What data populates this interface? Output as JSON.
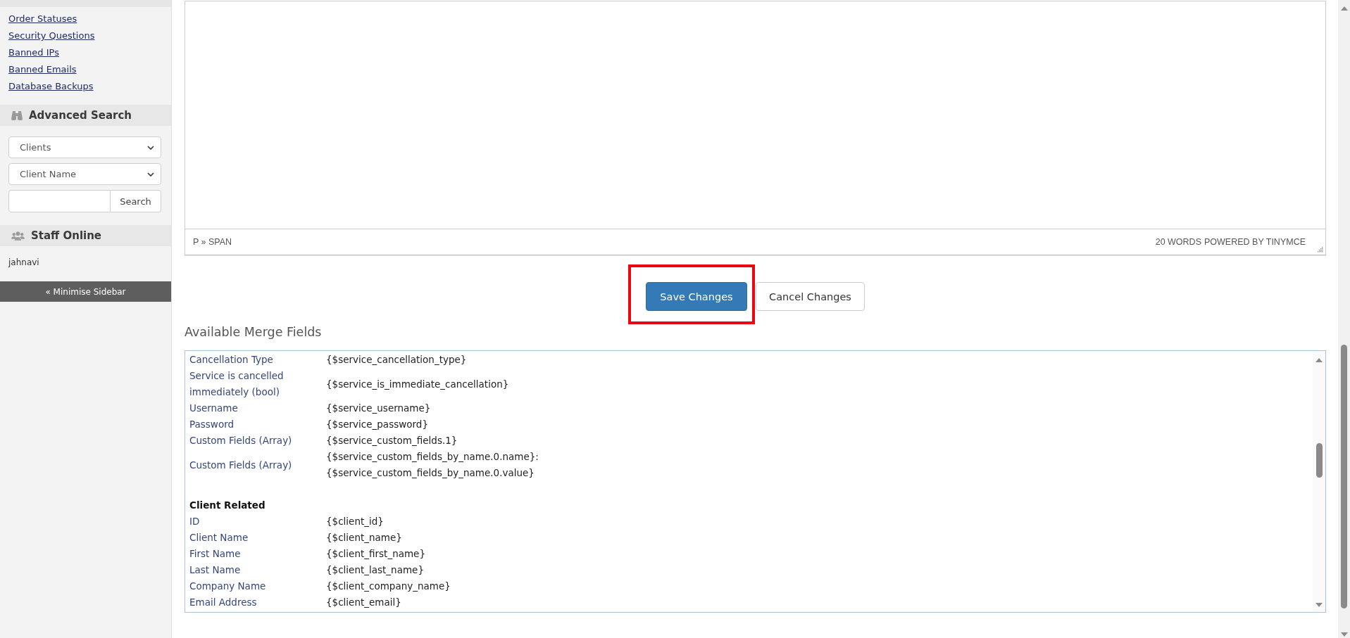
{
  "sidebar": {
    "links": [
      "Order Statuses",
      "Security Questions",
      "Banned IPs",
      "Banned Emails",
      "Database Backups"
    ],
    "advanced_search": {
      "title": "Advanced Search",
      "type_select": "Clients",
      "field_select": "Client Name",
      "search_button": "Search"
    },
    "staff_online": {
      "title": "Staff Online",
      "staff": [
        "jahnavi"
      ]
    },
    "minimise_button": "« Minimise Sidebar"
  },
  "editor": {
    "path": "P » SPAN",
    "word_count": "20 WORDS",
    "branding": "POWERED BY TINYMCE"
  },
  "actions": [
    {
      "label": "Save Changes",
      "kind": "save",
      "highlighted": true
    },
    {
      "label": "Cancel Changes",
      "kind": "cancel",
      "highlighted": false
    }
  ],
  "merge_fields": {
    "title": "Available Merge Fields",
    "rows": [
      {
        "kind": "field",
        "label": "Cancellation Type",
        "value": "{$service_cancellation_type}"
      },
      {
        "kind": "field",
        "label": "Service is cancelled immediately (bool)",
        "value": "{$service_is_immediate_cancellation}"
      },
      {
        "kind": "field",
        "label": "Username",
        "value": "{$service_username}"
      },
      {
        "kind": "field",
        "label": "Password",
        "value": "{$service_password}"
      },
      {
        "kind": "field",
        "label": "Custom Fields (Array)",
        "value": "{$service_custom_fields.1}"
      },
      {
        "kind": "field",
        "label": "Custom Fields (Array)",
        "value": "{$service_custom_fields_by_name.0.name}:\n{$service_custom_fields_by_name.0.value}"
      },
      {
        "kind": "heading",
        "label": "Client Related"
      },
      {
        "kind": "field",
        "label": "ID",
        "value": "{$client_id}"
      },
      {
        "kind": "field",
        "label": "Client Name",
        "value": "{$client_name}"
      },
      {
        "kind": "field",
        "label": "First Name",
        "value": "{$client_first_name}"
      },
      {
        "kind": "field",
        "label": "Last Name",
        "value": "{$client_last_name}"
      },
      {
        "kind": "field",
        "label": "Company Name",
        "value": "{$client_company_name}"
      },
      {
        "kind": "field",
        "label": "Email Address",
        "value": "{$client_email}"
      }
    ]
  }
}
